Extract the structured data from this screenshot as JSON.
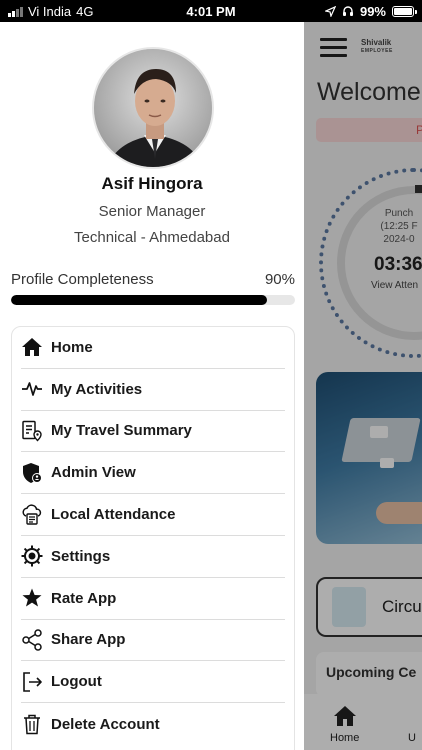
{
  "status_bar": {
    "carrier": "Vi India",
    "network": "4G",
    "time": "4:01 PM",
    "battery": "99%"
  },
  "profile": {
    "name": "Asif Hingora",
    "role": "Senior Manager",
    "department": "Technical - Ahmedabad"
  },
  "profile_completeness": {
    "label": "Profile Completeness",
    "percent_label": "90%",
    "value": 0.9
  },
  "menu": {
    "items": [
      {
        "label": "Home",
        "icon": "home-icon"
      },
      {
        "label": "My Activities",
        "icon": "activity-icon"
      },
      {
        "label": "My Travel Summary",
        "icon": "travel-summary-icon"
      },
      {
        "label": "Admin View",
        "icon": "admin-shield-icon"
      },
      {
        "label": "Local Attendance",
        "icon": "local-attendance-icon"
      },
      {
        "label": "Settings",
        "icon": "settings-gear-icon"
      },
      {
        "label": "Rate App",
        "icon": "star-icon"
      },
      {
        "label": "Share App",
        "icon": "share-icon"
      },
      {
        "label": "Logout",
        "icon": "logout-icon"
      },
      {
        "label": "Delete Account",
        "icon": "trash-icon"
      }
    ]
  },
  "background_app": {
    "brand": "Shivalik",
    "brand_sub": "EMPLOYEE",
    "welcome": "Welcome",
    "pink_text": "P",
    "clock_punch": "Punch",
    "clock_time_paren": "(12:25 F",
    "clock_date": "2024-0",
    "clock_time": "03:36",
    "clock_view": "View Atten",
    "circular": "Circu",
    "upcoming": "Upcoming Ce",
    "nav_home": "Home",
    "nav_second": "U"
  },
  "colors": {
    "accent": "#000000",
    "progress_track": "#e7e7e7",
    "clock_dots": "#5c7aa3",
    "pink_banner": "#fbd9d9"
  }
}
